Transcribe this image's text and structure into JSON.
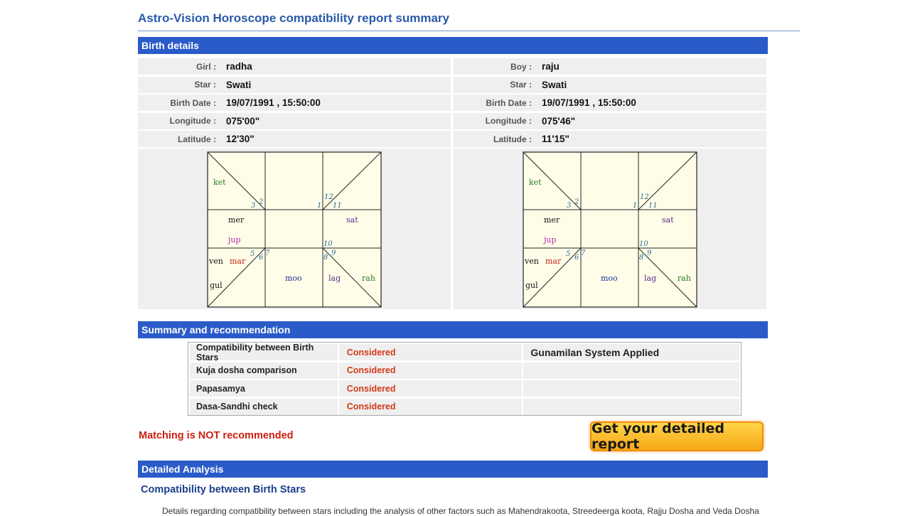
{
  "page_title": "Astro-Vision Horoscope compatibility report summary",
  "sections": {
    "birth_details": "Birth details",
    "summary": "Summary and recommendation",
    "detailed": "Detailed Analysis"
  },
  "girl": {
    "rows": [
      {
        "label": "Girl :",
        "value": "radha"
      },
      {
        "label": "Star :",
        "value": "Swati"
      },
      {
        "label": "Birth Date :",
        "value": "19/07/1991 , 15:50:00"
      },
      {
        "label": "Longitude :",
        "value": "075'00\""
      },
      {
        "label": "Latitude :",
        "value": "12'30\""
      }
    ]
  },
  "boy": {
    "rows": [
      {
        "label": "Boy :",
        "value": "raju"
      },
      {
        "label": "Star :",
        "value": "Swati"
      },
      {
        "label": "Birth Date :",
        "value": "19/07/1991 , 15:50:00"
      },
      {
        "label": "Longitude :",
        "value": "075'46\""
      },
      {
        "label": "Latitude :",
        "value": "11'15\""
      }
    ]
  },
  "chart": {
    "planets": {
      "ket": "ket",
      "mer": "mer",
      "jup": "jup",
      "sat": "sat",
      "ven": "ven",
      "mar": "mar",
      "gul": "gul",
      "moo": "moo",
      "lag": "lag",
      "rah": "rah"
    },
    "house_numbers": {
      "n1": "1",
      "n2": "2",
      "n3": "3",
      "n5": "5",
      "n6": "6",
      "n7": "7",
      "n8": "8",
      "n9": "9",
      "n10": "10",
      "n11": "11",
      "n12": "12"
    },
    "colors": {
      "background": "#fffde8",
      "ket": "#2a7a2a",
      "mer": "#111111",
      "jup": "#b02ab0",
      "sat": "#5a2a8a",
      "ven": "#111111",
      "mar": "#c0281a",
      "gul": "#111111",
      "moo": "#1a2a9a",
      "lag": "#5a2a8a",
      "rah": "#2a7a2a"
    }
  },
  "summary": {
    "rows": [
      {
        "check": "Compatibility between Birth Stars",
        "status": "Considered",
        "note": "Gunamilan System Applied"
      },
      {
        "check": "Kuja dosha comparison",
        "status": "Considered",
        "note": ""
      },
      {
        "check": "Papasamya",
        "status": "Considered",
        "note": ""
      },
      {
        "check": "Dasa-Sandhi check",
        "status": "Considered",
        "note": ""
      }
    ]
  },
  "verdict": "Matching is NOT recommended",
  "report_button": "Get your detailed report",
  "detailed": {
    "sub_heading": "Compatibility between Birth Stars",
    "text": "Details regarding compatibility between stars including the analysis of other factors such as Mahendrakoota, Streedeerga koota, Rajju Dosha and Veda Dosha"
  },
  "colors": {
    "section_bar": "#2a5bc9",
    "title": "#2a5aa8",
    "status": "#d23a1a",
    "verdict": "#cc1f10"
  }
}
